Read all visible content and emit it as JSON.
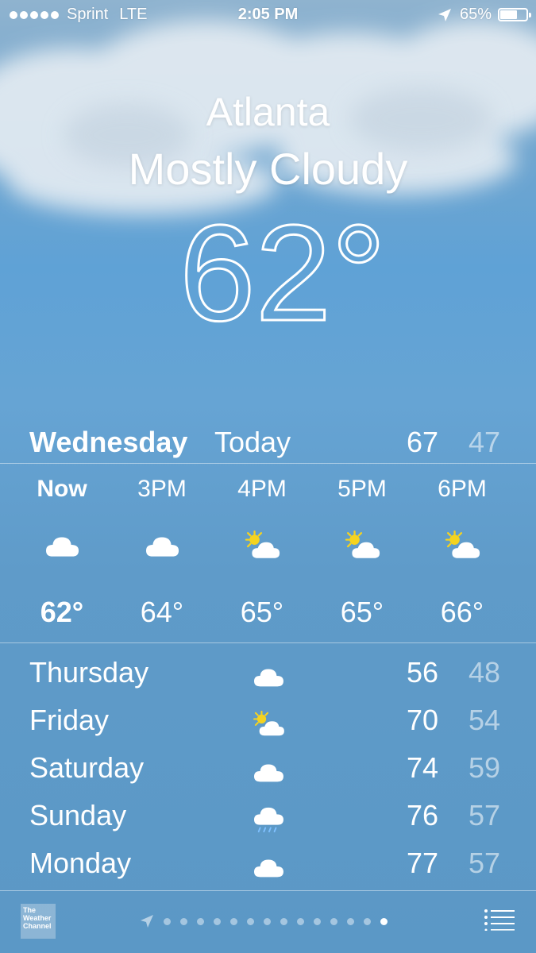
{
  "status_bar": {
    "carrier": "Sprint",
    "network": "LTE",
    "time": "2:05 PM",
    "battery": "65%",
    "battery_level": 0.65
  },
  "header": {
    "city": "Atlanta",
    "condition": "Mostly Cloudy",
    "temperature": "62°"
  },
  "today": {
    "day": "Wednesday",
    "label": "Today",
    "high": "67",
    "low": "47"
  },
  "hourly": [
    {
      "time": "Now",
      "icon": "cloud-icon",
      "temp": "62°"
    },
    {
      "time": "3PM",
      "icon": "cloud-icon",
      "temp": "64°"
    },
    {
      "time": "4PM",
      "icon": "partly-sunny-icon",
      "temp": "65°"
    },
    {
      "time": "5PM",
      "icon": "partly-sunny-icon",
      "temp": "65°"
    },
    {
      "time": "6PM",
      "icon": "partly-sunny-icon",
      "temp": "66°"
    }
  ],
  "daily": [
    {
      "day": "Thursday",
      "icon": "cloud-icon",
      "high": "56",
      "low": "48"
    },
    {
      "day": "Friday",
      "icon": "partly-sunny-icon",
      "high": "70",
      "low": "54"
    },
    {
      "day": "Saturday",
      "icon": "cloud-icon",
      "high": "74",
      "low": "59"
    },
    {
      "day": "Sunday",
      "icon": "rain-icon",
      "high": "76",
      "low": "57"
    },
    {
      "day": "Monday",
      "icon": "cloud-icon",
      "high": "77",
      "low": "57"
    }
  ],
  "footer": {
    "logo_text": "The Weather Channel",
    "page_count": 14,
    "active_page": 14
  },
  "colors": {
    "sun": "#f5d31f",
    "cloud": "#ffffff",
    "rain": "#7fc0ff"
  }
}
